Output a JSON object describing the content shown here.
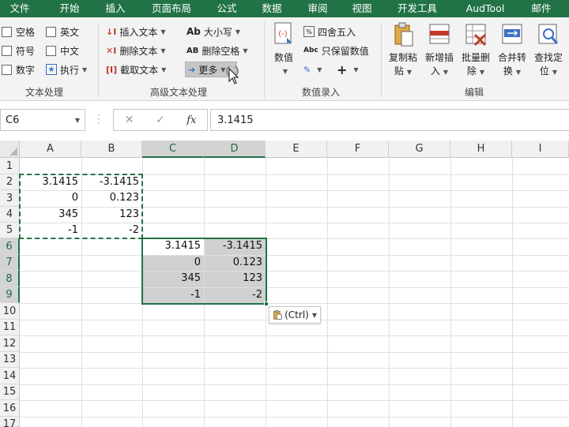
{
  "menu": [
    "文件",
    "开始",
    "插入",
    "页面布局",
    "公式",
    "数据",
    "审阅",
    "视图",
    "开发工具",
    "AudTool",
    "邮件"
  ],
  "ribbon": {
    "text_group": {
      "label": "文本处理",
      "items": [
        "空格",
        "英文",
        "符号",
        "中文",
        "数字",
        "执行"
      ]
    },
    "advanced_group": {
      "label": "高级文本处理",
      "insert_text": "插入文本",
      "delete_text": "删除文本",
      "extract_text": "截取文本",
      "case": "大小写",
      "case_icon": "Ab",
      "delete_spaces": "删除空格",
      "delete_spaces_icon": "AB",
      "more": "更多"
    },
    "number_group": {
      "label": "数值录入",
      "value": "数值",
      "round": "四舍五入",
      "keep_value": "只保留数值",
      "abc": "Abc",
      "plus": "+"
    },
    "edit_group": {
      "label": "编辑",
      "copy_paste": [
        "复制粘",
        "贴"
      ],
      "new_insert": [
        "新增插",
        "入"
      ],
      "batch_delete": [
        "批量删",
        "除"
      ],
      "merge_convert": [
        "合并转",
        "换"
      ],
      "find_locate": [
        "查找定",
        "位"
      ]
    }
  },
  "formula_bar": {
    "name_box": "C6",
    "cancel": "✕",
    "confirm": "✓",
    "fx": "fx",
    "formula": "3.1415"
  },
  "grid": {
    "columns": [
      "A",
      "B",
      "C",
      "D",
      "E",
      "F",
      "G",
      "H",
      "I"
    ],
    "rows": [
      "1",
      "2",
      "3",
      "4",
      "5",
      "6",
      "7",
      "8",
      "9",
      "10",
      "11",
      "12",
      "13",
      "14",
      "15",
      "16",
      "17"
    ],
    "source": [
      [
        "3.1415",
        "-3.1415"
      ],
      [
        "0",
        "0.123"
      ],
      [
        "345",
        "123"
      ],
      [
        "-1",
        "-2"
      ]
    ],
    "pasted": [
      [
        "3.1415",
        "-3.1415"
      ],
      [
        "0",
        "0.123"
      ],
      [
        "345",
        "123"
      ],
      [
        "-1",
        "-2"
      ]
    ]
  },
  "paste_options": "(Ctrl)",
  "colors": {
    "accent": "#217346",
    "selection": "#d0d0d0"
  }
}
